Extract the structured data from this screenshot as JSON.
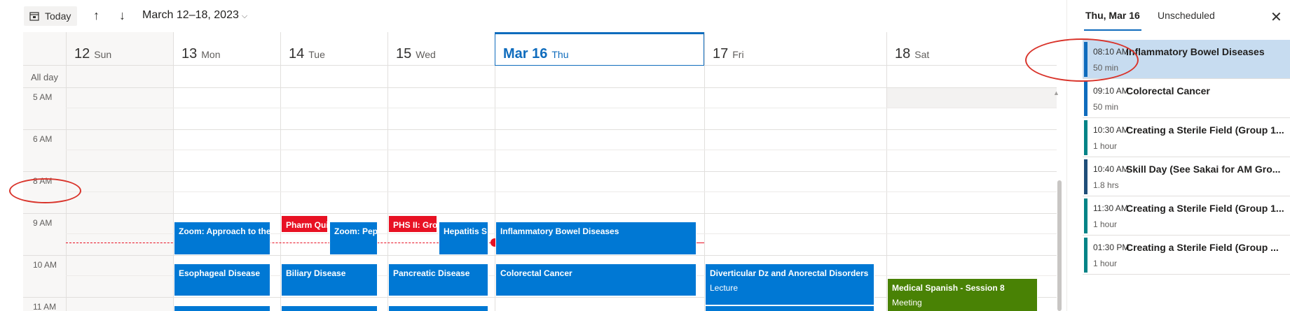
{
  "toolbar": {
    "today_label": "Today",
    "range_label": "March 12–18, 2023"
  },
  "days": [
    {
      "num": "12",
      "name": "Sun"
    },
    {
      "num": "13",
      "name": "Mon"
    },
    {
      "num": "14",
      "name": "Tue"
    },
    {
      "num": "15",
      "name": "Wed"
    },
    {
      "num": "Mar 16",
      "name": "Thu"
    },
    {
      "num": "17",
      "name": "Fri"
    },
    {
      "num": "18",
      "name": "Sat"
    }
  ],
  "allday_label": "All day",
  "hours": [
    "5 AM",
    "6 AM",
    "8 AM",
    "9 AM",
    "10 AM",
    "11 AM"
  ],
  "events": {
    "mon_zoom": "Zoom: Approach to the",
    "mon_eso": "Esophageal Disease",
    "tue_pharm": "Pharm Qui",
    "tue_zoom": "Zoom: Pep",
    "tue_biliary": "Biliary Disease",
    "wed_phs": "PHS II: Gro",
    "wed_hep": "Hepatitis S",
    "wed_panc": "Pancreatic Disease",
    "thu_ibd": "Inflammatory Bowel Diseases",
    "thu_crc": "Colorectal Cancer",
    "fri_div": "Diverticular Dz and Anorectal Disorders",
    "fri_div_sub": "Lecture",
    "sat_spanish": "Medical Spanish - Session 8",
    "sat_spanish_sub": "Meeting"
  },
  "colors": {
    "accent": "#0f6cbd",
    "event_blue": "#0078d4",
    "event_red": "#e81123",
    "event_green": "#498205",
    "now_line": "#e81123"
  },
  "panel": {
    "tab_day": "Thu, Mar 16",
    "tab_unscheduled": "Unscheduled",
    "agenda": [
      {
        "time": "08:10 AM",
        "title": "Inflammatory Bowel Diseases",
        "duration": "50 min"
      },
      {
        "time": "09:10 AM",
        "title": "Colorectal Cancer",
        "duration": "50 min"
      },
      {
        "time": "10:30 AM",
        "title": "Creating a Sterile Field (Group 1...",
        "duration": "1 hour"
      },
      {
        "time": "10:40 AM",
        "title": "Skill Day (See Sakai for AM Gro...",
        "duration": "1.8 hrs"
      },
      {
        "time": "11:30 AM",
        "title": "Creating a Sterile Field (Group 1...",
        "duration": "1 hour"
      },
      {
        "time": "01:30 PM",
        "title": "Creating a Sterile Field (Group ...",
        "duration": "1 hour"
      }
    ]
  }
}
